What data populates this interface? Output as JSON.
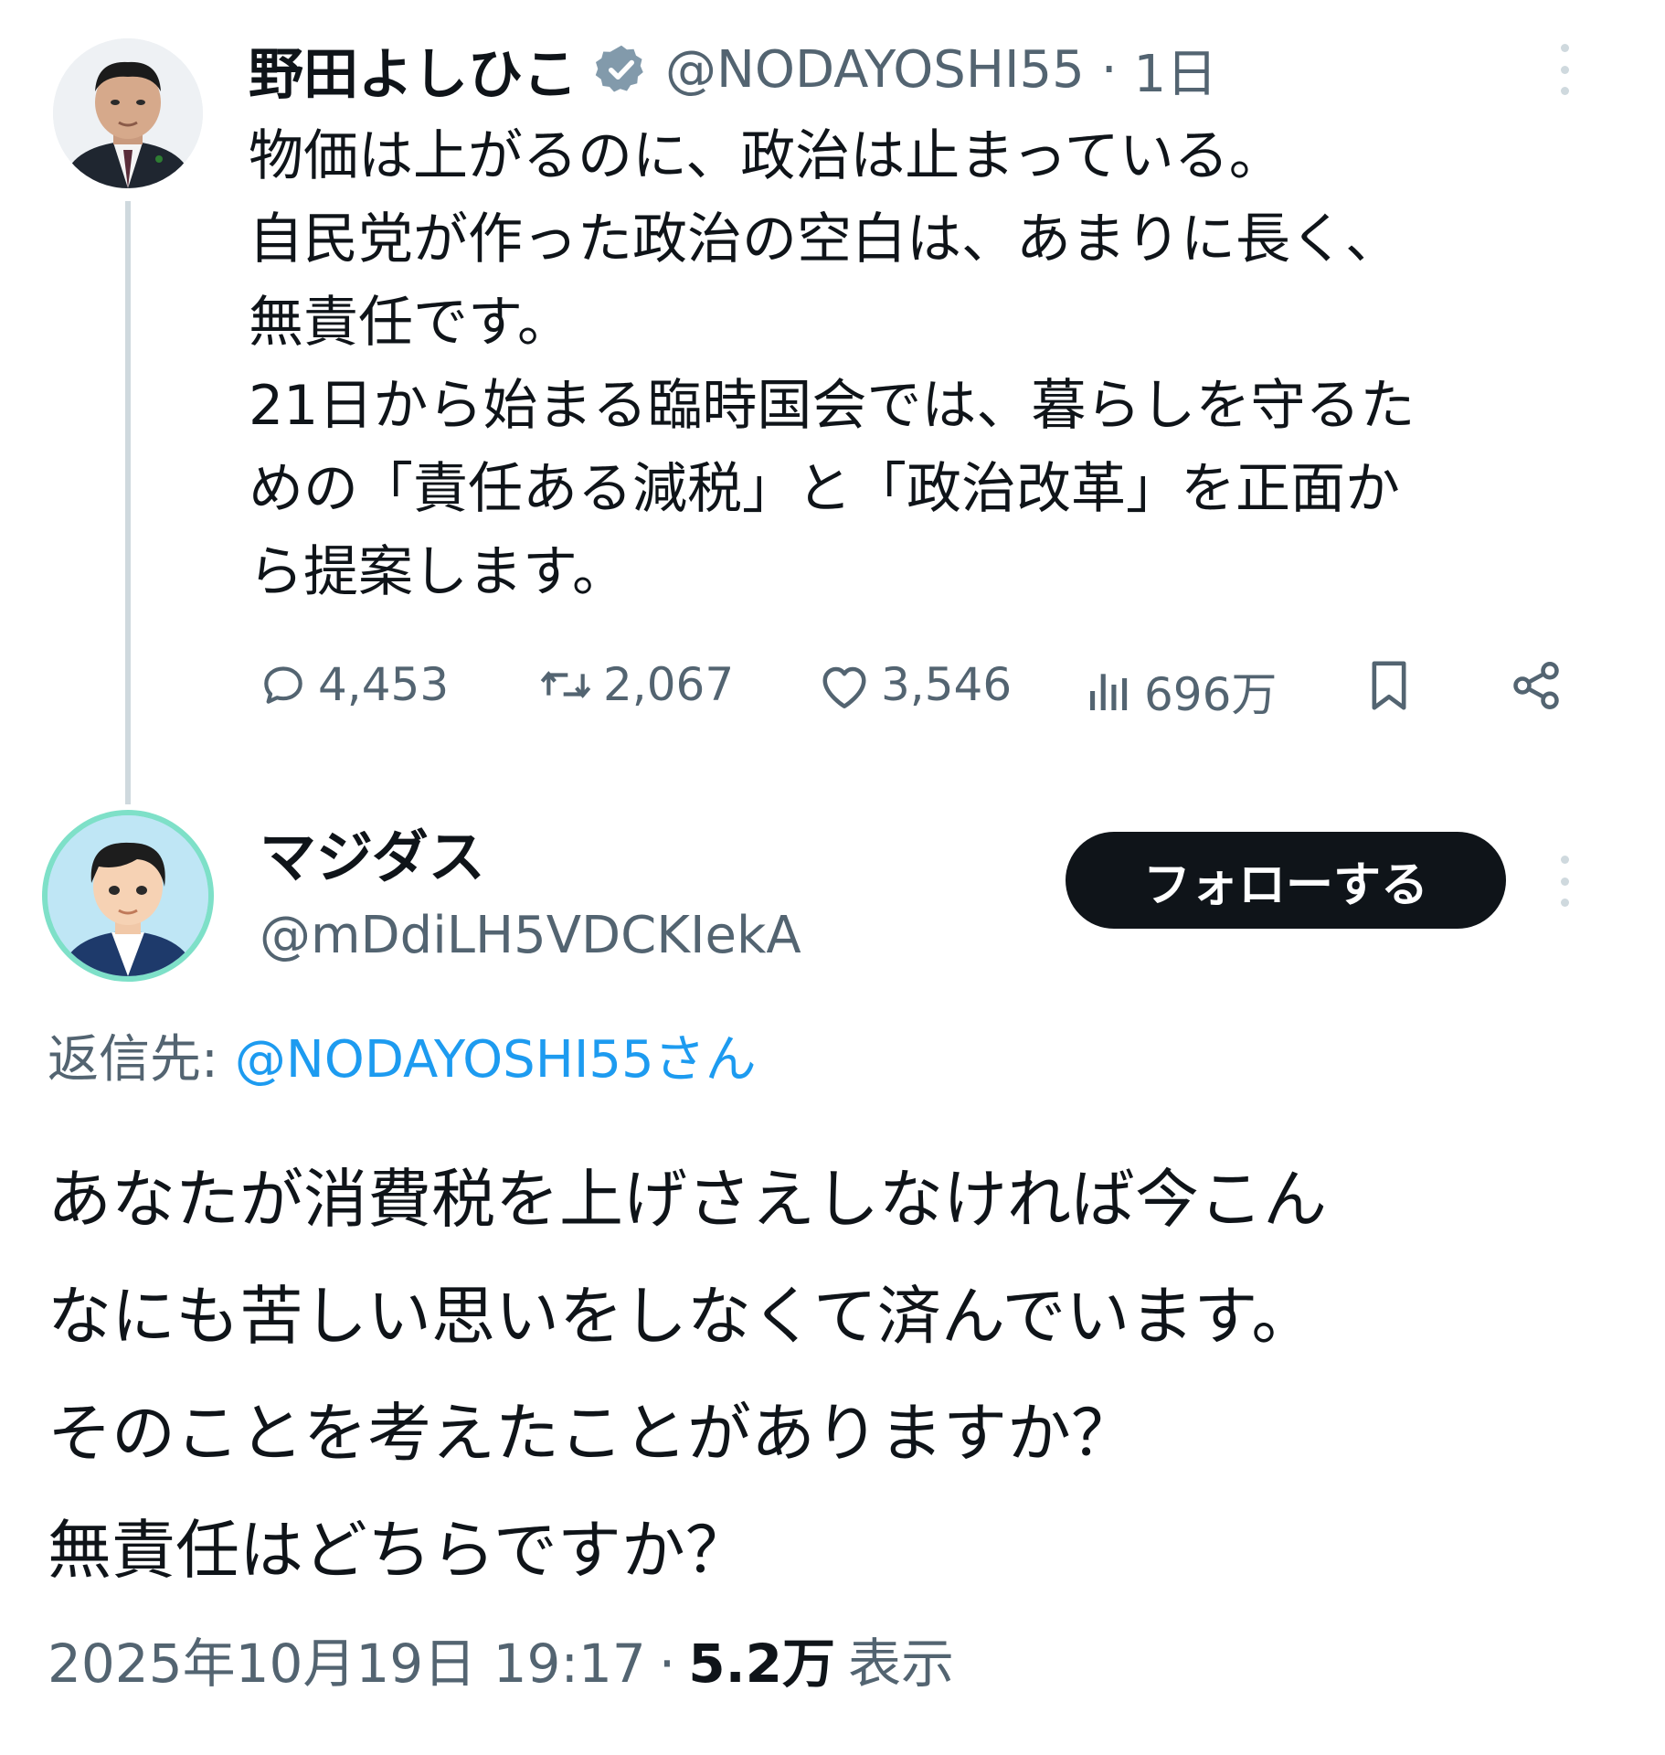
{
  "original_tweet": {
    "author_name": "野田よしひこ",
    "handle": "@NODAYOSHI55",
    "separator": "·",
    "time_ago": "1日",
    "text_lines": [
      "物価は上がるのに、政治は止まっている。",
      "自民党が作った政治の空白は、あまりに長く、",
      "無責任です。",
      "21日から始まる臨時国会では、暮らしを守るた",
      "めの「責任ある減税」と「政治改革」を正面か",
      "ら提案します。"
    ],
    "metrics": {
      "replies": "4,453",
      "reposts": "2,067",
      "likes": "3,546",
      "views": "696万"
    }
  },
  "reply": {
    "author_name": "マジダス",
    "handle": "@mDdiLH5VDCKIekA",
    "follow_label": "フォローする",
    "reply_to_label": "返信先:",
    "reply_to_handle": "@NODAYOSHI55さん",
    "text_lines": [
      "あなたが消費税を上げさえしなければ今こん",
      "なにも苦しい思いをしなくて済んでいます。",
      "そのことを考えたことがありますか？",
      "無責任はどちらですか？"
    ],
    "timestamp": "2025年10月19日 19:17",
    "separator": "·",
    "views_count": "5.2万",
    "views_label": "表示"
  },
  "colors": {
    "text": "#0f1419",
    "muted": "#536471",
    "link": "#1d9bf0",
    "verified_badge": "#829aab",
    "follow_button": "#0f1419",
    "thread_line": "#cfd9de"
  }
}
